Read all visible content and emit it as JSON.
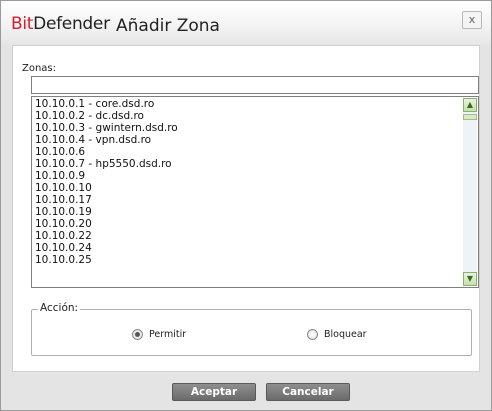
{
  "titlebar": {
    "brand_red": "Bit",
    "brand_dark": "Defender",
    "title": "Añadir Zona",
    "close_label": "x"
  },
  "zones": {
    "label": "Zonas:",
    "input_value": "",
    "items": [
      "10.10.0.1 - core.dsd.ro",
      "10.10.0.2 - dc.dsd.ro",
      "10.10.0.3 - gwintern.dsd.ro",
      "10.10.0.4 - vpn.dsd.ro",
      "10.10.0.6",
      "10.10.0.7 - hp5550.dsd.ro",
      "10.10.0.9",
      "10.10.0.10",
      "10.10.0.17",
      "10.10.0.19",
      "10.10.0.20",
      "10.10.0.22",
      "10.10.0.24",
      "10.10.0.25"
    ]
  },
  "action": {
    "legend": "Acción:",
    "options": [
      {
        "label": "Permitir",
        "selected": true
      },
      {
        "label": "Bloquear",
        "selected": false
      }
    ]
  },
  "buttons": {
    "accept": "Aceptar",
    "cancel": "Cancelar"
  },
  "colors": {
    "brand_red": "#d4202c",
    "scroll_accent": "#c6dfae",
    "button": "#7a7a7a"
  }
}
